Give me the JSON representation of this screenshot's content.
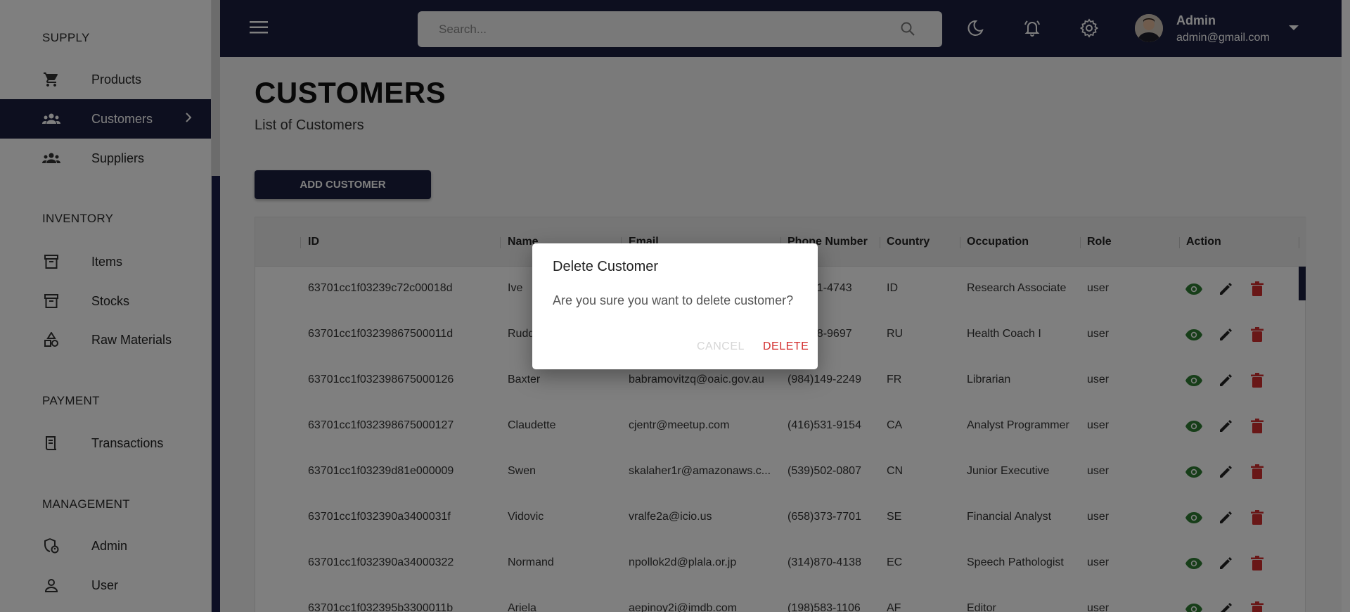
{
  "sidebar": {
    "sections": [
      {
        "title": "SUPPLY"
      },
      {
        "title": "INVENTORY"
      },
      {
        "title": "PAYMENT"
      },
      {
        "title": "MANAGEMENT"
      }
    ],
    "items": [
      {
        "label": "Products",
        "icon": "cart-icon"
      },
      {
        "label": "Customers",
        "icon": "groups-icon",
        "active": true
      },
      {
        "label": "Suppliers",
        "icon": "groups-icon"
      },
      {
        "label": "Items",
        "icon": "archive-icon"
      },
      {
        "label": "Stocks",
        "icon": "archive-icon"
      },
      {
        "label": "Raw Materials",
        "icon": "category-icon"
      },
      {
        "label": "Transactions",
        "icon": "receipt-icon"
      },
      {
        "label": "Admin",
        "icon": "admin-icon"
      },
      {
        "label": "User",
        "icon": "person-icon"
      }
    ]
  },
  "topbar": {
    "search_placeholder": "Search...",
    "user_name": "Admin",
    "user_email": "admin@gmail.com"
  },
  "page": {
    "title": "CUSTOMERS",
    "subtitle": "List of Customers",
    "add_button": "ADD CUSTOMER"
  },
  "table": {
    "columns": [
      "ID",
      "Name",
      "Email",
      "Phone Number",
      "Country",
      "Occupation",
      "Role",
      "Action"
    ],
    "rows": [
      {
        "id": "63701cc1f03239c72c00018d",
        "name": "Ive",
        "email": "",
        "phone": "(...)951-4743",
        "country": "ID",
        "occupation": "Research Associate",
        "role": "user"
      },
      {
        "id": "63701cc1f03239867500011d",
        "name": "Rudd",
        "email": "",
        "phone": "(...)888-9697",
        "country": "RU",
        "occupation": "Health Coach I",
        "role": "user"
      },
      {
        "id": "63701cc1f032398675000126",
        "name": "Baxter",
        "email": "babramovitzq@oaic.gov.au",
        "phone": "(984)149-2249",
        "country": "FR",
        "occupation": "Librarian",
        "role": "user"
      },
      {
        "id": "63701cc1f032398675000127",
        "name": "Claudette",
        "email": "cjentr@meetup.com",
        "phone": "(416)531-9154",
        "country": "CA",
        "occupation": "Analyst Programmer",
        "role": "user"
      },
      {
        "id": "63701cc1f03239d81e000009",
        "name": "Swen",
        "email": "skalaher1r@amazonaws.c...",
        "phone": "(539)502-0807",
        "country": "CN",
        "occupation": "Junior Executive",
        "role": "user"
      },
      {
        "id": "63701cc1f032390a3400031f",
        "name": "Vidovic",
        "email": "vralfe2a@icio.us",
        "phone": "(658)373-7701",
        "country": "SE",
        "occupation": "Financial Analyst",
        "role": "user"
      },
      {
        "id": "63701cc1f032390a34000322",
        "name": "Normand",
        "email": "npollok2d@plala.or.jp",
        "phone": "(314)870-4138",
        "country": "EC",
        "occupation": "Speech Pathologist",
        "role": "user"
      },
      {
        "id": "63701cc1f032395b3300011b",
        "name": "Ariela",
        "email": "aepinoy2i@imdb.com",
        "phone": "(198)583-1106",
        "country": "AF",
        "occupation": "Editor",
        "role": "user"
      }
    ]
  },
  "dialog": {
    "title": "Delete Customer",
    "message": "Are you sure you want to delete customer?",
    "cancel": "CANCEL",
    "delete": "DELETE"
  },
  "colors": {
    "brand_dark": "#1a1e3f",
    "view_green": "#2e7d32",
    "delete_red": "#d32f2f"
  }
}
